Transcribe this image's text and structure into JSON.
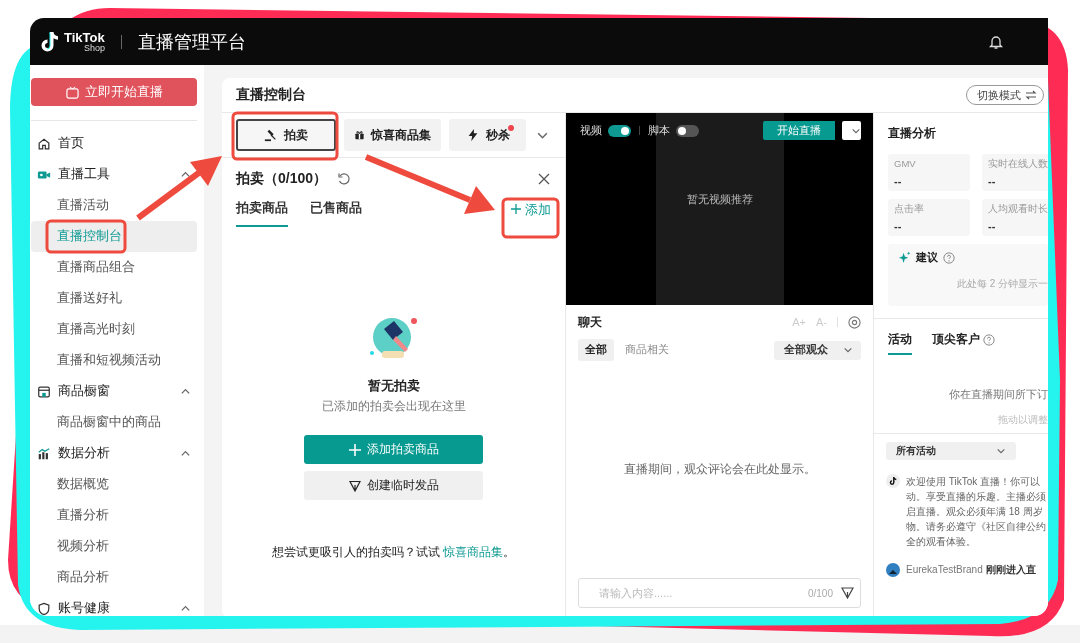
{
  "header": {
    "logo_text": "TikTok",
    "logo_sub": "Shop",
    "title": "直播管理平台"
  },
  "sidebar": {
    "start_button": "立即开始直播",
    "items": [
      {
        "label": "首页",
        "kind": "home",
        "selected": false
      },
      {
        "label": "直播工具",
        "kind": "video",
        "selected": false,
        "expanded": true,
        "children": [
          {
            "label": "直播活动",
            "selected": false
          },
          {
            "label": "直播控制台",
            "selected": true
          },
          {
            "label": "直播商品组合",
            "selected": false
          },
          {
            "label": "直播送好礼",
            "selected": false
          },
          {
            "label": "直播高光时刻",
            "selected": false
          },
          {
            "label": "直播和短视频活动",
            "selected": false
          }
        ]
      },
      {
        "label": "商品橱窗",
        "kind": "store",
        "selected": false,
        "expanded": true,
        "children": [
          {
            "label": "商品橱窗中的商品",
            "selected": false
          }
        ]
      },
      {
        "label": "数据分析",
        "kind": "chart",
        "selected": false,
        "expanded": true,
        "children": [
          {
            "label": "数据概览",
            "selected": false
          },
          {
            "label": "直播分析",
            "selected": false
          },
          {
            "label": "视频分析",
            "selected": false
          },
          {
            "label": "商品分析",
            "selected": false
          }
        ]
      },
      {
        "label": "账号健康",
        "kind": "health",
        "selected": false,
        "expanded": true
      }
    ]
  },
  "console": {
    "title": "直播控制台",
    "mode_button": "切换模式"
  },
  "tools": {
    "tabs": [
      {
        "label": "拍卖",
        "kind": "gavel",
        "selected": true,
        "dot": false
      },
      {
        "label": "惊喜商品集",
        "kind": "gift",
        "selected": false,
        "dot": false
      },
      {
        "label": "秒杀",
        "kind": "flash",
        "selected": false,
        "dot": true
      }
    ]
  },
  "auction": {
    "title": "拍卖（0/100）",
    "tabs": [
      {
        "label": "拍卖商品",
        "selected": true
      },
      {
        "label": "已售商品",
        "selected": false
      }
    ],
    "add_link": "添加",
    "empty_title": "暂无拍卖",
    "empty_hint": "已添加的拍卖会出现在这里",
    "add_button": "添加拍卖商品",
    "create_button": "创建临时发品",
    "footer": "想尝试更吸引人的拍卖吗？试试 ",
    "footer_link": "惊喜商品集",
    "footer_end": "。"
  },
  "video": {
    "toggles": [
      {
        "label": "视频",
        "on": true
      },
      {
        "label": "脚本",
        "on": false
      }
    ],
    "start_button": "开始直播",
    "empty": "暂无视频推荐"
  },
  "chat": {
    "title": "聊天",
    "font_up": "A+",
    "font_down": "A-",
    "filters": [
      {
        "label": "全部",
        "selected": true
      },
      {
        "label": "商品相关",
        "selected": false
      }
    ],
    "audience": "全部观众",
    "empty": "直播期间，观众评论会在此处显示。",
    "placeholder": "请输入内容......",
    "counter": "0/100"
  },
  "analysis": {
    "title": "直播分析",
    "metrics": [
      {
        "label": "GMV",
        "value": "--"
      },
      {
        "label": "实时在线人数",
        "value": "--"
      },
      {
        "label": "点击率",
        "value": "--"
      },
      {
        "label": "人均观看时长",
        "value": "--"
      }
    ],
    "suggest_title": "建议",
    "suggest_hint": "此处每 2 分钟显示一",
    "tabs": [
      {
        "label": "活动",
        "selected": true,
        "help": false
      },
      {
        "label": "顶尖客户",
        "selected": false,
        "help": true
      }
    ],
    "orders_hint": "你在直播期间所下订",
    "drag_hint": "拖动以调整",
    "activity_filter": "所有活动",
    "messages": [
      {
        "kind": "system",
        "lines": [
          "欢迎使用 TikTok 直播！你可以",
          "动。享受直播的乐趣。主播必须",
          "启直播。观众必须年满 18 周岁",
          "物。请务必遵守《社区自律公约",
          "全的观看体验。"
        ]
      },
      {
        "kind": "user",
        "text": "EurekaTestBrand **刚刚进入直**"
      }
    ]
  }
}
